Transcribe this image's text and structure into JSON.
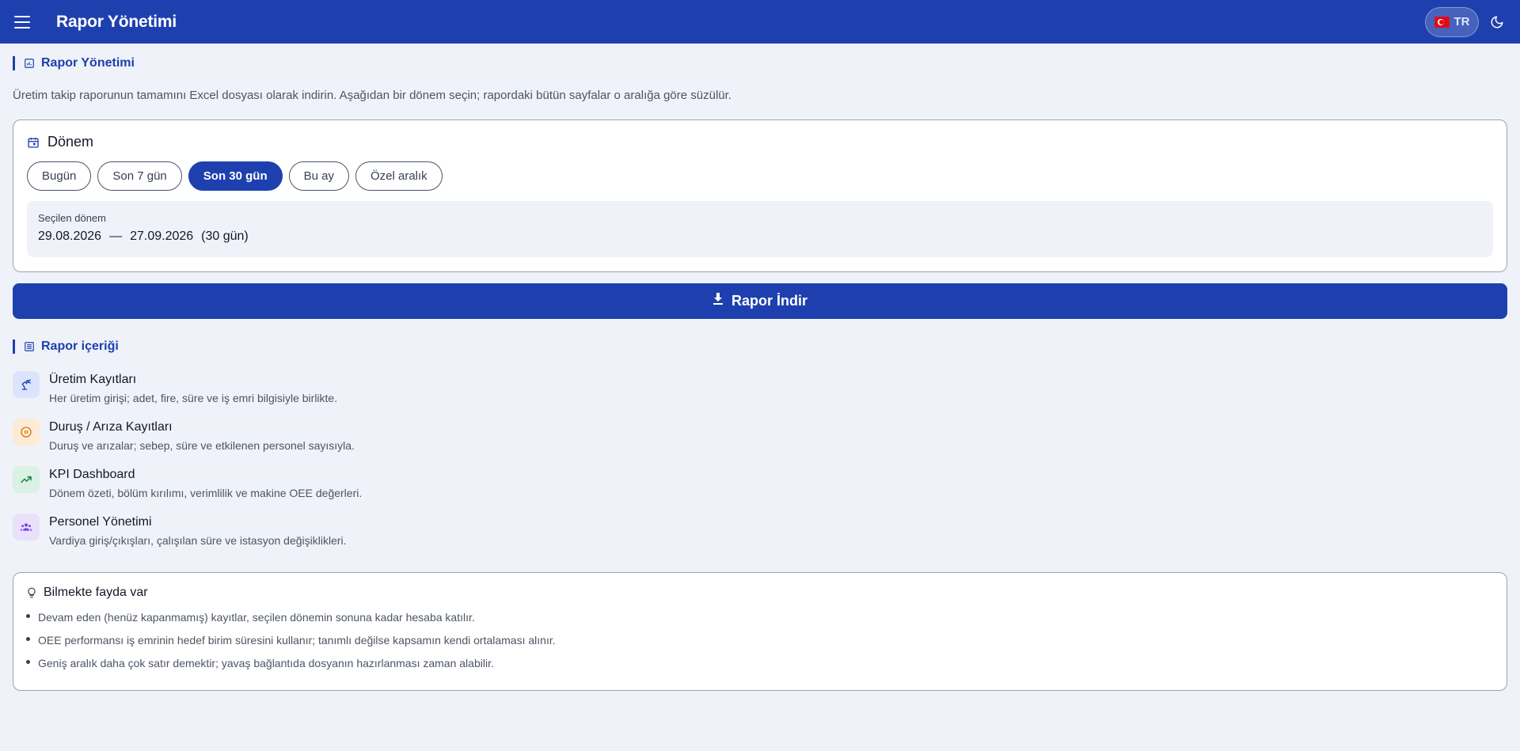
{
  "appbar": {
    "title": "Rapor Yönetimi",
    "lang_label": "TR",
    "icons": {
      "menu": "menu-icon",
      "theme": "moon-icon",
      "flag": "turkey-flag-icon"
    }
  },
  "page": {
    "section_title": "Rapor Yönetimi",
    "intro": "Üretim takip raporunun tamamını Excel dosyası olarak indirin. Aşağıdan bir dönem seçin; rapordaki bütün sayfalar o aralığa göre süzülür."
  },
  "period": {
    "title": "Dönem",
    "chips": [
      {
        "label": "Bugün",
        "active": false
      },
      {
        "label": "Son 7 gün",
        "active": false
      },
      {
        "label": "Son 30 gün",
        "active": true
      },
      {
        "label": "Bu ay",
        "active": false
      },
      {
        "label": "Özel aralık",
        "active": false
      }
    ],
    "selected_label": "Seçilen dönem",
    "start": "29.08.2026",
    "separator": "—",
    "end": "27.09.2026",
    "days": "(30 gün)"
  },
  "download": {
    "label": "Rapor İndir"
  },
  "contents": {
    "title": "Rapor içeriği",
    "items": [
      {
        "title": "Üretim Kayıtları",
        "desc": "Her üretim girişi; adet, fire, süre ve iş emri bilgisiyle birlikte.",
        "icon": "robot-arm-icon",
        "bg": "#dbe4fb",
        "fg": "#1e40af"
      },
      {
        "title": "Duruş / Arıza Kayıtları",
        "desc": "Duruş ve arızalar; sebep, süre ve etkilenen personel sayısıyla.",
        "icon": "pause-circle-icon",
        "bg": "#fdebd6",
        "fg": "#d97706"
      },
      {
        "title": "KPI Dashboard",
        "desc": "Dönem özeti, bölüm kırılımı, verimlilik ve makine OEE değerleri.",
        "icon": "trending-up-icon",
        "bg": "#d9f2e3",
        "fg": "#15803d"
      },
      {
        "title": "Personel Yönetimi",
        "desc": "Vardiya giriş/çıkışları, çalışılan süre ve istasyon değişiklikleri.",
        "icon": "people-icon",
        "bg": "#e9e1fa",
        "fg": "#7c3aed"
      }
    ]
  },
  "tips": {
    "title": "Bilmekte fayda var",
    "items": [
      "Devam eden (henüz kapanmamış) kayıtlar, seçilen dönemin sonuna kadar hesaba katılır.",
      "OEE performansı iş emrinin hedef birim süresini kullanır; tanımlı değilse kapsamın kendi ortalaması alınır.",
      "Geniş aralık daha çok satır demektir; yavaş bağlantıda dosyanın hazırlanması zaman alabilir."
    ]
  }
}
